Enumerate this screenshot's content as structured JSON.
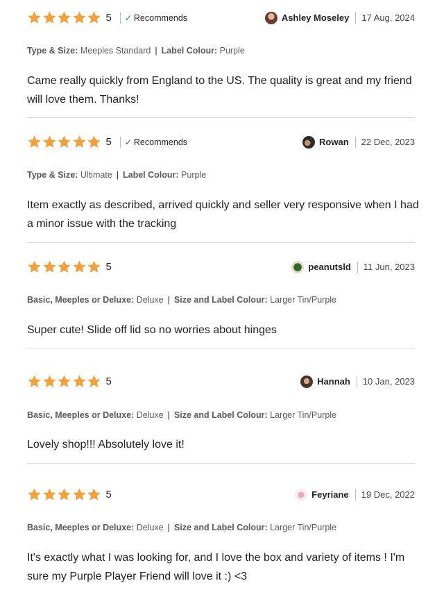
{
  "colors": {
    "star": "#F1A03A",
    "divider": "#D9D9D9",
    "text": "#222222",
    "meta": "#595959"
  },
  "reviews": [
    {
      "rating": "5",
      "recommends": "Recommends",
      "user": "Ashley Moseley",
      "date": "17 Aug, 2024",
      "var1_label": "Type & Size:",
      "var1_value": "Meeples Standard",
      "var2_label": "Label Colour:",
      "var2_value": "Purple",
      "text": "Came really quickly from England to the US. The quality is great and my friend will love them. Thanks!"
    },
    {
      "rating": "5",
      "recommends": "Recommends",
      "user": "Rowan",
      "date": "22 Dec, 2023",
      "var1_label": "Type & Size:",
      "var1_value": "Ultimate",
      "var2_label": "Label Colour:",
      "var2_value": "Purple",
      "text": "Item exactly as described, arrived quickly and seller very responsive when I had a minor issue with the tracking"
    },
    {
      "rating": "5",
      "user": "peanutsld",
      "date": "11 Jun, 2023",
      "var1_label": "Basic, Meeples or Deluxe:",
      "var1_value": "Deluxe",
      "var2_label": "Size and Label Colour:",
      "var2_value": "Larger Tin/Purple",
      "text": "Super cute! Slide off lid so no worries about hinges"
    },
    {
      "rating": "5",
      "user": "Hannah",
      "date": "10 Jan, 2023",
      "var1_label": "Basic, Meeples or Deluxe:",
      "var1_value": "Deluxe",
      "var2_label": "Size and Label Colour:",
      "var2_value": "Larger Tin/Purple",
      "text": "Lovely shop!!! Absolutely love it!"
    },
    {
      "rating": "5",
      "user": "Feyriane",
      "date": "19 Dec, 2022",
      "var1_label": "Basic, Meeples or Deluxe:",
      "var1_value": "Deluxe",
      "var2_label": "Size and Label Colour:",
      "var2_value": "Larger Tin/Purple",
      "text": "It's exactly what I was looking for, and I love the box and variety of items ! I'm sure my Purple Player Friend will love it :) <3"
    }
  ]
}
